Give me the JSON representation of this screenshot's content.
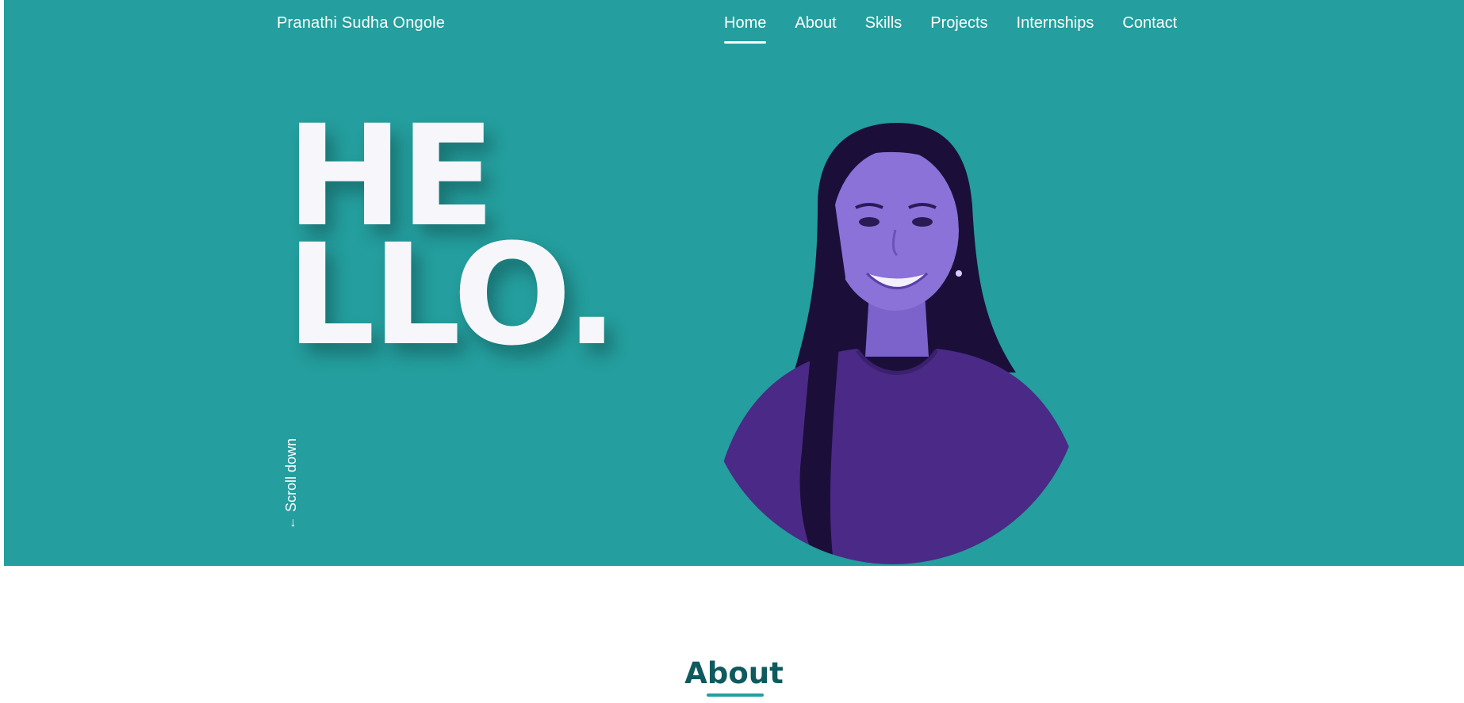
{
  "header": {
    "brand": "Pranathi Sudha Ongole",
    "nav": [
      {
        "label": "Home",
        "active": true
      },
      {
        "label": "About"
      },
      {
        "label": "Skills"
      },
      {
        "label": "Projects"
      },
      {
        "label": "Internships"
      },
      {
        "label": "Contact"
      }
    ]
  },
  "hero": {
    "line1": "HE",
    "line2": "LLO.",
    "scroll_label": "Scroll down",
    "scroll_icon": "arrow-down-icon"
  },
  "about": {
    "heading": "About"
  },
  "colors": {
    "hero_bg": "#249e9e",
    "heading": "#0f5a5e",
    "shirt": "#4a2a86",
    "hair": "#1b0f3a",
    "skin": "#8a72d8"
  }
}
